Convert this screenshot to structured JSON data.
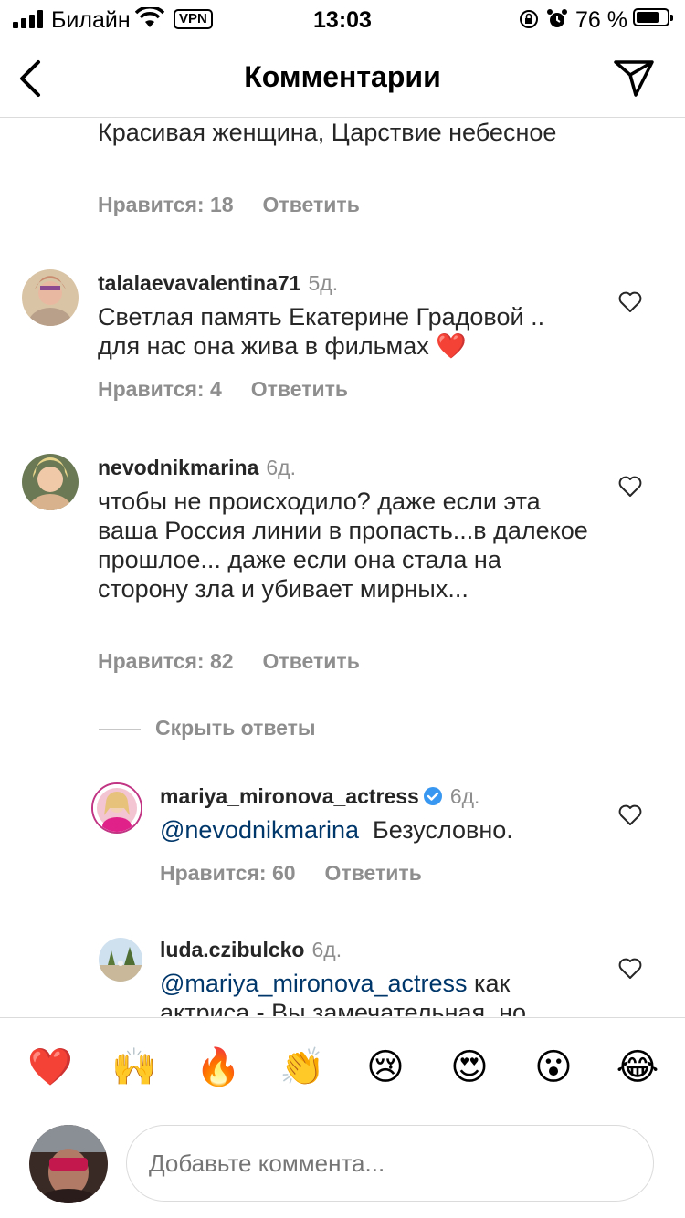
{
  "status_bar": {
    "carrier": "Билайн",
    "vpn": "VPN",
    "time": "13:03",
    "battery_percent_text": "76 %",
    "battery_level": 0.76
  },
  "header": {
    "title": "Комментарии"
  },
  "comments": [
    {
      "text": "Красивая женщина, Царствие небесное",
      "likes": "Нравится: 18",
      "reply": "Ответить"
    },
    {
      "username": "talalaevavalentina71",
      "age": "5д.",
      "text": "Светлая память  Екатерине Градовой .. для нас она жива в фильмах ❤️",
      "likes": "Нравится: 4",
      "reply": "Ответить"
    },
    {
      "username": "nevodnikmarina",
      "age": "6д.",
      "text": "чтобы не происходило? даже если эта ваша Россия линии в пропасть...в далекое прошлое... даже если она стала на сторону зла и убивает мирных...",
      "likes": "Нравится: 82",
      "reply": "Ответить"
    }
  ],
  "hide_replies": "Скрыть ответы",
  "replies": [
    {
      "username": "mariya_mironova_actress",
      "age": "6д.",
      "mention": "@nevodnikmarina",
      "text": "Безусловно.",
      "likes": "Нравится: 60",
      "reply": "Ответить"
    },
    {
      "username": "luda.czibulcko",
      "age": "6д.",
      "mention": "@mariya_mironova_actress",
      "text": " как актриса - Вы замечательная, но"
    }
  ],
  "emoji_bar": [
    "❤️",
    "🙌",
    "🔥",
    "👏",
    "😢",
    "😍",
    "😮",
    "😂"
  ],
  "composer": {
    "placeholder": "Добавьте коммента..."
  }
}
